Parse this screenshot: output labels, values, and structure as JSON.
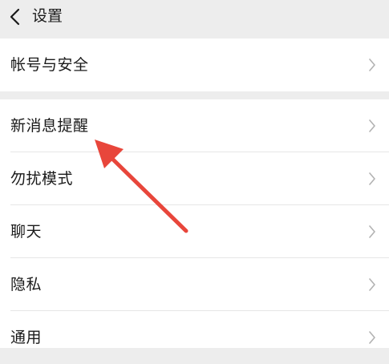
{
  "header": {
    "title": "设置"
  },
  "account_group": {
    "items": [
      {
        "label": "帐号与安全"
      }
    ]
  },
  "settings_group": {
    "items": [
      {
        "label": "新消息提醒"
      },
      {
        "label": "勿扰模式"
      },
      {
        "label": "聊天"
      },
      {
        "label": "隐私"
      },
      {
        "label": "通用"
      }
    ]
  },
  "icons": {
    "back": "chevron-left-icon",
    "row_chevron": "chevron-right-icon"
  },
  "annotation": {
    "arrow_color": "#e8463b",
    "points_to": "新消息提醒"
  },
  "colors": {
    "background": "#ededed",
    "row_background": "#ffffff",
    "text": "#1a1a1a",
    "chevron": "#b2b2b2"
  }
}
